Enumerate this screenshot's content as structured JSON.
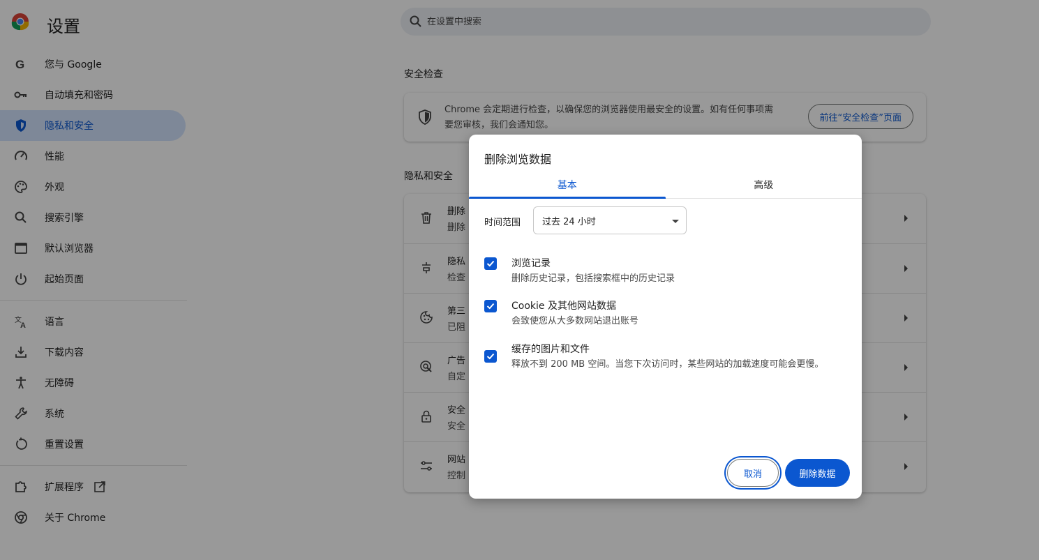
{
  "header": {
    "title": "设置",
    "search_placeholder": "在设置中搜索"
  },
  "sidebar": {
    "items": [
      {
        "label": "您与 Google",
        "icon": "google-icon"
      },
      {
        "label": "自动填充和密码",
        "icon": "key-icon"
      },
      {
        "label": "隐私和安全",
        "icon": "shield-icon",
        "active": true
      },
      {
        "label": "性能",
        "icon": "gauge-icon"
      },
      {
        "label": "外观",
        "icon": "palette-icon"
      },
      {
        "label": "搜索引擎",
        "icon": "search-icon"
      },
      {
        "label": "默认浏览器",
        "icon": "browser-window-icon"
      },
      {
        "label": "起始页面",
        "icon": "power-icon"
      },
      {
        "label": "语言",
        "icon": "translate-icon"
      },
      {
        "label": "下载内容",
        "icon": "download-icon"
      },
      {
        "label": "无障碍",
        "icon": "accessibility-icon"
      },
      {
        "label": "系统",
        "icon": "wrench-icon"
      },
      {
        "label": "重置设置",
        "icon": "reset-icon"
      },
      {
        "label": "扩展程序",
        "icon": "puzzle-icon"
      },
      {
        "label": "关于 Chrome",
        "icon": "chrome-icon"
      }
    ]
  },
  "main": {
    "safety_check": {
      "title": "安全检查",
      "description": "Chrome 会定期进行检查，以确保您的浏览器使用最安全的设置。如有任何事项需要您审核，我们会通知您。",
      "button_label": "前往“安全检查”页面"
    },
    "privacy": {
      "title": "隐私和安全",
      "rows": [
        {
          "title": "删除",
          "subtitle": "删除",
          "icon": "trash-icon"
        },
        {
          "title": "隐私",
          "subtitle": "检查",
          "icon": "privacy-guide-icon"
        },
        {
          "title": "第三",
          "subtitle": "已阻",
          "icon": "cookie-icon"
        },
        {
          "title": "广告",
          "subtitle": "自定",
          "icon": "ads-icon"
        },
        {
          "title": "安全",
          "subtitle": "安全",
          "icon": "lock-icon"
        },
        {
          "title": "网站",
          "subtitle": "控制",
          "icon": "tune-icon"
        }
      ]
    }
  },
  "dialog": {
    "title": "删除浏览数据",
    "tabs": [
      "基本",
      "高级"
    ],
    "active_tab": "基本",
    "time_range_label": "时间范围",
    "time_range_value": "过去 24 小时",
    "options": [
      {
        "title": "浏览记录",
        "subtitle": "删除历史记录，包括搜索框中的历史记录",
        "checked": true
      },
      {
        "title": "Cookie 及其他网站数据",
        "subtitle": "会致使您从大多数网站退出账号",
        "checked": true
      },
      {
        "title": "缓存的图片和文件",
        "subtitle": "释放不到 200 MB 空间。当您下次访问时，某些网站的加载速度可能会更慢。",
        "checked": true
      }
    ],
    "cancel_label": "取消",
    "delete_label": "删除数据"
  },
  "colors": {
    "accent": "#0b57d0",
    "active_nav_bg": "#d3e3fd",
    "search_bg": "#edf0f6"
  }
}
